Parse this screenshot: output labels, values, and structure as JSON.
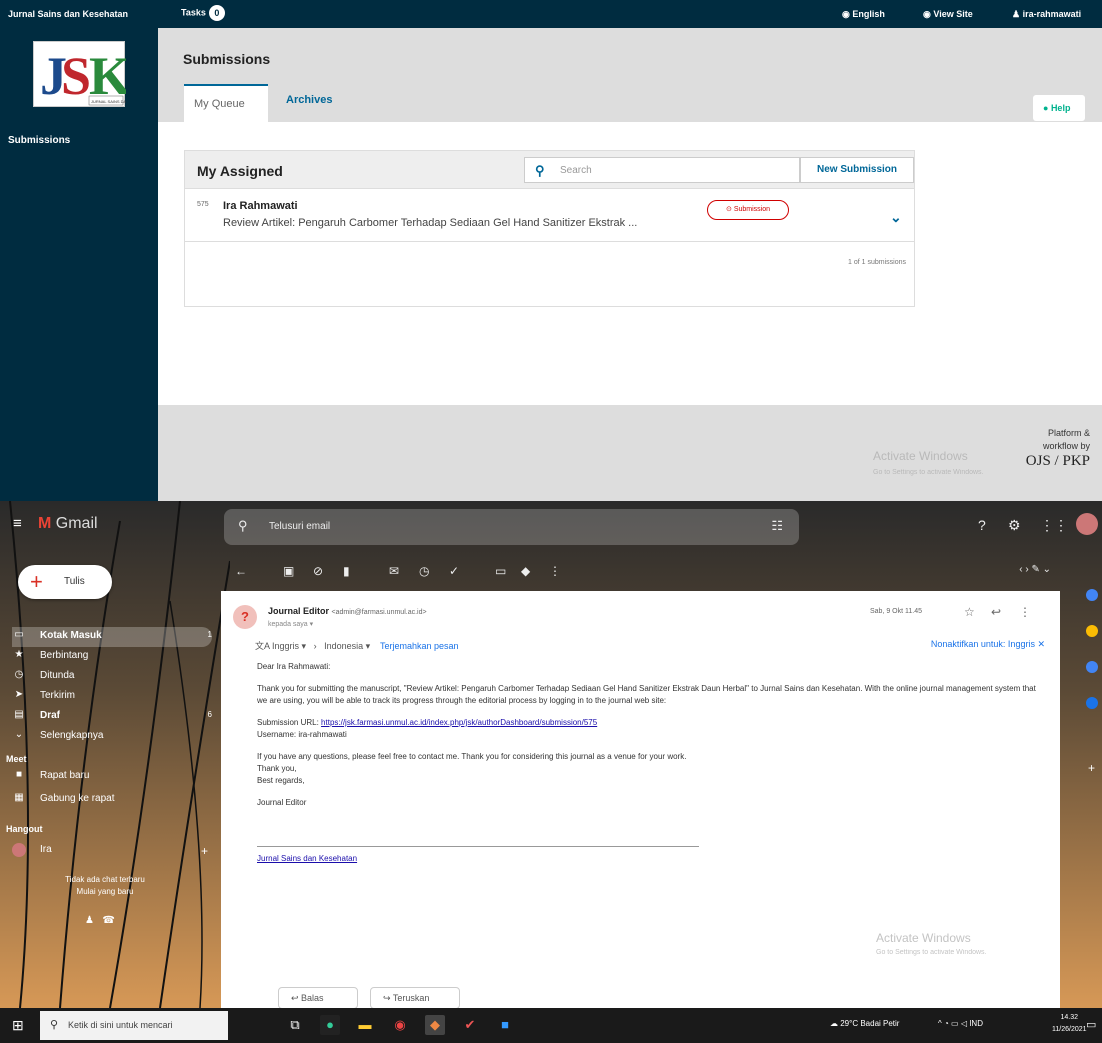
{
  "ojs": {
    "topbar": {
      "site_name": "Jurnal Sains dan Kesehatan",
      "tasks_label": "Tasks",
      "tasks_count": "0",
      "language": "English",
      "view_site": "View Site",
      "user": "ira-rahmawati"
    },
    "sidebar": {
      "logo_text": "JSK",
      "logo_caption": "JURNAL SAINS DAN KESEHATAN",
      "items": [
        {
          "label": "Submissions"
        }
      ]
    },
    "page_title": "Submissions",
    "tabs": [
      {
        "label": "My Queue"
      },
      {
        "label": "Archives"
      }
    ],
    "help_label": "Help",
    "list": {
      "title": "My Assigned",
      "search_placeholder": "Search",
      "new_submission": "New Submission",
      "items": [
        {
          "id": "575",
          "author": "Ira Rahmawati",
          "title": "Review Artikel: Pengaruh Carbomer Terhadap Sediaan Gel Hand Sanitizer Ekstrak ...",
          "stage": "Submission"
        }
      ],
      "count_text": "1 of 1 submissions"
    },
    "footer": {
      "line1": "Platform &",
      "line2": "workflow by",
      "brand": "OJS / PKP"
    },
    "watermark": {
      "title": "Activate Windows",
      "sub": "Go to Settings to activate Windows."
    }
  },
  "gmail": {
    "app_name": "Gmail",
    "search_placeholder": "Telusuri email",
    "compose_label": "Tulis",
    "nav": [
      {
        "label": "Kotak Masuk",
        "count": "1"
      },
      {
        "label": "Berbintang",
        "count": ""
      },
      {
        "label": "Ditunda",
        "count": ""
      },
      {
        "label": "Terkirim",
        "count": ""
      },
      {
        "label": "Draf",
        "count": "6"
      },
      {
        "label": "Selengkapnya",
        "count": ""
      }
    ],
    "meet": {
      "title": "Meet",
      "items": [
        {
          "label": "Rapat baru"
        },
        {
          "label": "Gabung ke rapat"
        }
      ]
    },
    "hangout": {
      "title": "Hangout",
      "user": "Ira",
      "no_chat": "Tidak ada chat terbaru",
      "start_new": "Mulai yang baru"
    },
    "message": {
      "avatar": "?",
      "sender": "Journal Editor",
      "sender_email": "<admin@farmasi.unmul.ac.id>",
      "to": "kepada saya",
      "date": "Sab, 9 Okt 11.45",
      "translate": {
        "from": "Inggris",
        "to": "Indonesia",
        "action": "Terjemahkan pesan",
        "off": "Nonaktifkan untuk: Inggris"
      },
      "greeting": "Dear Ira Rahmawati:",
      "para1": "Thank you for submitting the manuscript, \"Review Artikel: Pengaruh Carbomer Terhadap Sediaan Gel Hand Sanitizer Ekstrak Daun Herbal\" to Jurnal Sains dan Kesehatan. With the online journal management system that we are using, you will be able to track its progress through the editorial process by logging in to the journal web site:",
      "url_label": "Submission URL:",
      "url": "https://jsk.farmasi.unmul.ac.id/index.php/jsk/authorDashboard/submission/575",
      "username": "Username: ira-rahmawati",
      "para2": "If you have any questions, please feel free to contact me. Thank you for considering this journal as a venue for your work.",
      "thanks": "Thank you,",
      "regards": "Best regards,",
      "signature_name": "Journal Editor",
      "signature_link": "Jurnal Sains dan Kesehatan",
      "reply": "Balas",
      "forward": "Teruskan"
    },
    "watermark": {
      "title": "Activate Windows",
      "sub": "Go to Settings to activate Windows."
    }
  },
  "taskbar": {
    "search_placeholder": "Ketik di sini untuk mencari",
    "weather": "29°C  Badai Petir",
    "lang": "IND",
    "time": "14.32",
    "date": "11/26/2021"
  },
  "colors": {
    "ojs_dark": "#002c40",
    "ojs_link": "#006798",
    "gmail_red": "#d93025",
    "link_blue": "#1a0dab"
  }
}
